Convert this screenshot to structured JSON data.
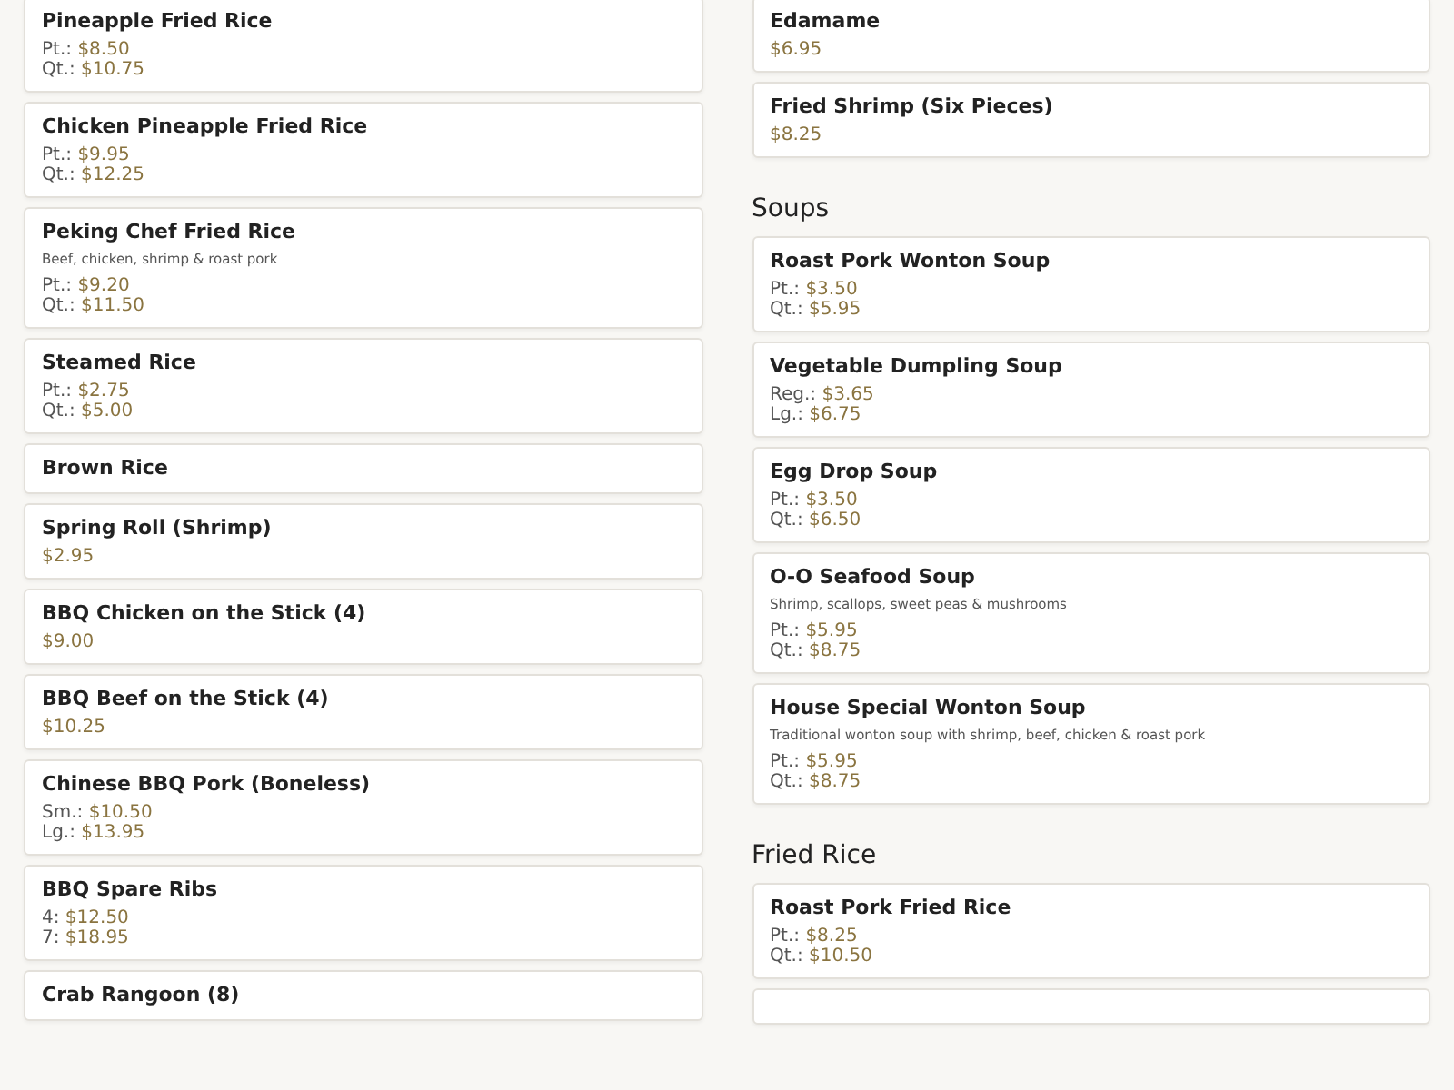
{
  "columns": [
    {
      "entries": [
        {
          "kind": "item",
          "name": "Pineapple Fried Rice",
          "prices": [
            {
              "label": "Pt.:",
              "value": "$8.50"
            },
            {
              "label": "Qt.:",
              "value": "$10.75"
            }
          ]
        },
        {
          "kind": "item",
          "name": "Chicken Pineapple Fried Rice",
          "prices": [
            {
              "label": "Pt.:",
              "value": "$9.95"
            },
            {
              "label": "Qt.:",
              "value": "$12.25"
            }
          ]
        },
        {
          "kind": "item",
          "name": "Peking Chef Fried Rice",
          "description": "Beef, chicken, shrimp & roast pork",
          "prices": [
            {
              "label": "Pt.:",
              "value": "$9.20"
            },
            {
              "label": "Qt.:",
              "value": "$11.50"
            }
          ]
        },
        {
          "kind": "item",
          "name": "Steamed Rice",
          "prices": [
            {
              "label": "Pt.:",
              "value": "$2.75"
            },
            {
              "label": "Qt.:",
              "value": "$5.00"
            }
          ]
        },
        {
          "kind": "item",
          "name": "Brown Rice"
        },
        {
          "kind": "item",
          "name": "Spring Roll (Shrimp)",
          "prices": [
            {
              "value": "$2.95"
            }
          ]
        },
        {
          "kind": "item",
          "name": "BBQ Chicken on the Stick (4)",
          "prices": [
            {
              "value": "$9.00"
            }
          ]
        },
        {
          "kind": "item",
          "name": "BBQ Beef on the Stick (4)",
          "prices": [
            {
              "value": "$10.25"
            }
          ]
        },
        {
          "kind": "item",
          "name": "Chinese BBQ Pork (Boneless)",
          "prices": [
            {
              "label": "Sm.:",
              "value": "$10.50"
            },
            {
              "label": "Lg.:",
              "value": "$13.95"
            }
          ]
        },
        {
          "kind": "item",
          "name": "BBQ Spare Ribs",
          "prices": [
            {
              "label": "4:",
              "value": "$12.50"
            },
            {
              "label": "7:",
              "value": "$18.95"
            }
          ]
        },
        {
          "kind": "item",
          "name": "Crab Rangoon (8)"
        }
      ]
    },
    {
      "entries": [
        {
          "kind": "item",
          "name": "Edamame",
          "prices": [
            {
              "value": "$6.95"
            }
          ]
        },
        {
          "kind": "item",
          "name": "Fried Shrimp (Six Pieces)",
          "prices": [
            {
              "value": "$8.25"
            }
          ]
        },
        {
          "kind": "heading",
          "name": "Soups"
        },
        {
          "kind": "item",
          "name": "Roast Pork Wonton Soup",
          "prices": [
            {
              "label": "Pt.:",
              "value": "$3.50"
            },
            {
              "label": "Qt.:",
              "value": "$5.95"
            }
          ]
        },
        {
          "kind": "item",
          "name": "Vegetable Dumpling Soup",
          "prices": [
            {
              "label": "Reg.:",
              "value": "$3.65"
            },
            {
              "label": "Lg.:",
              "value": "$6.75"
            }
          ]
        },
        {
          "kind": "item",
          "name": "Egg Drop Soup",
          "prices": [
            {
              "label": "Pt.:",
              "value": "$3.50"
            },
            {
              "label": "Qt.:",
              "value": "$6.50"
            }
          ]
        },
        {
          "kind": "item",
          "name": "O-O Seafood Soup",
          "description": "Shrimp, scallops, sweet peas & mushrooms",
          "prices": [
            {
              "label": "Pt.:",
              "value": "$5.95"
            },
            {
              "label": "Qt.:",
              "value": "$8.75"
            }
          ]
        },
        {
          "kind": "item",
          "name": "House Special Wonton Soup",
          "description": "Traditional wonton soup with shrimp, beef, chicken & roast pork",
          "prices": [
            {
              "label": "Pt.:",
              "value": "$5.95"
            },
            {
              "label": "Qt.:",
              "value": "$8.75"
            }
          ]
        },
        {
          "kind": "heading",
          "name": "Fried Rice"
        },
        {
          "kind": "item",
          "name": "Roast Pork Fried Rice",
          "prices": [
            {
              "label": "Pt.:",
              "value": "$8.25"
            },
            {
              "label": "Qt.:",
              "value": "$10.50"
            }
          ]
        },
        {
          "kind": "item"
        }
      ]
    }
  ]
}
